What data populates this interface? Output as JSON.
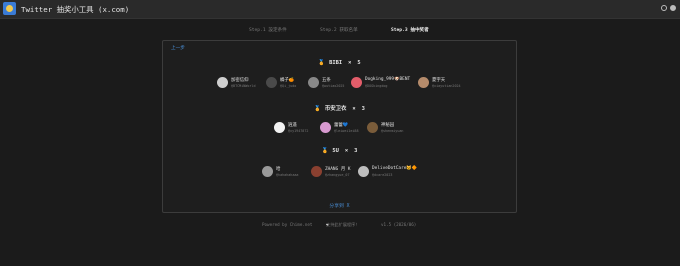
{
  "app": {
    "title": "Twitter 抽奖小工具 (x.com)"
  },
  "steps": [
    {
      "label": "Step.1 設定条件",
      "active": false
    },
    {
      "label": "Step.2 获取名单",
      "active": false
    },
    {
      "label": "Step.3 抽中奖者",
      "active": true
    }
  ],
  "panel": {
    "prev_label": "上一步",
    "next_label": "分享到 X",
    "prizes": [
      {
        "icon": "🏅",
        "name": "BIBI",
        "times": "×",
        "count": "5",
        "winners": [
          {
            "name": "加密信仰",
            "handle": "@BTCMiNWorld",
            "avatar_color": "#cfcfcf"
          },
          {
            "name": "橘子🍊",
            "handle": "@Qi_judo",
            "avatar_color": "#4a4a4a"
          },
          {
            "name": "五条",
            "handle": "@wutiao2025",
            "avatar_color": "#888888"
          },
          {
            "name": "Dogking_999🐶BENT",
            "handle": "@DOGkingdog",
            "avatar_color": "#e35d6a"
          },
          {
            "name": "夏宇天",
            "handle": "@xiayutian2024",
            "avatar_color": "#b58b6b"
          }
        ]
      },
      {
        "icon": "🏅",
        "name": "币安卫衣",
        "times": "×",
        "count": "3",
        "winners": [
          {
            "name": "逍遥",
            "handle": "@xy1947872",
            "avatar_color": "#f2f2f2"
          },
          {
            "name": "蕾蕾💙",
            "handle": "@leiwei1ei88",
            "avatar_color": "#d89ad0"
          },
          {
            "name": "神秘园",
            "handle": "@shenmiyuan",
            "avatar_color": "#7a5c3a"
          }
        ]
      },
      {
        "icon": "🏅",
        "name": "5U",
        "times": "×",
        "count": "3",
        "winners": [
          {
            "name": "哈",
            "handle": "@hahahahaaa",
            "avatar_color": "#9a9a9a"
          },
          {
            "name": "ZHANG 月 K",
            "handle": "@zhangyue_07",
            "avatar_color": "#8a4030"
          },
          {
            "name": "DeliveDotCare🐱🔶",
            "handle": "@dcare2023",
            "avatar_color": "#bdbdbd"
          }
        ]
      }
    ]
  },
  "footer": {
    "powered": "Powered by Chime.net",
    "support": "支持此扩展程序！",
    "version": "v1.5 (2026/06)"
  },
  "icons": {
    "app": "app-logo-icon",
    "settings": "gear-icon",
    "account": "account-icon",
    "support": "heart-icon"
  }
}
